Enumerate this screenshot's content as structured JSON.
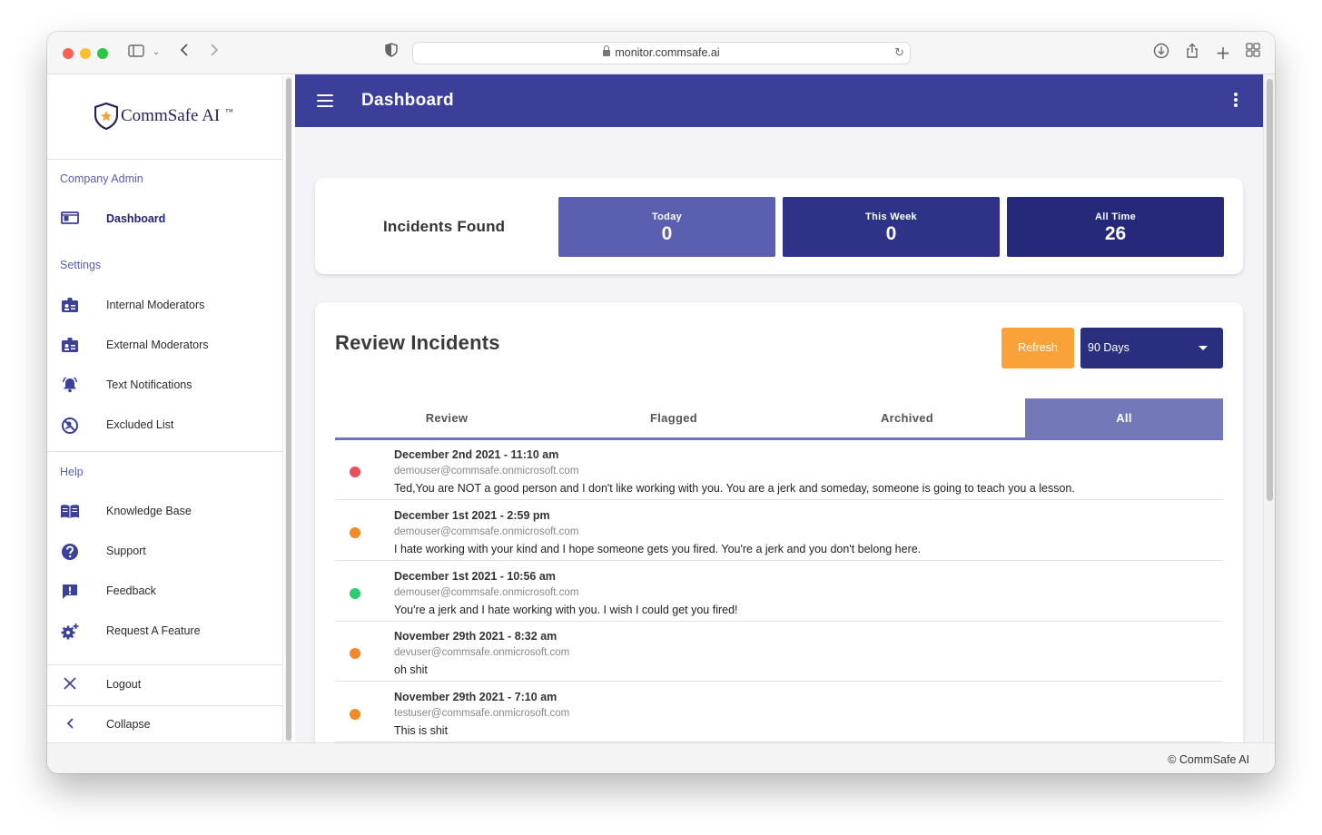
{
  "browser": {
    "url": "monitor.commsafe.ai"
  },
  "sidebar": {
    "brand": "CommSafe AI",
    "trademark": "™",
    "section_company": "Company Admin",
    "dashboard": "Dashboard",
    "section_settings": "Settings",
    "settings_items": [
      "Internal Moderators",
      "External Moderators",
      "Text Notifications",
      "Excluded List"
    ],
    "section_help": "Help",
    "help_items": [
      "Knowledge Base",
      "Support",
      "Feedback",
      "Request A Feature"
    ],
    "logout": "Logout",
    "collapse": "Collapse"
  },
  "header": {
    "title": "Dashboard"
  },
  "incidents_found": {
    "title": "Incidents Found",
    "stats": [
      {
        "label": "Today",
        "value": "0",
        "color": "#5a5fb0"
      },
      {
        "label": "This Week",
        "value": "0",
        "color": "#2f3388"
      },
      {
        "label": "All Time",
        "value": "26",
        "color": "#26297a"
      }
    ]
  },
  "review": {
    "title": "Review Incidents",
    "refresh_label": "Refresh",
    "range_value": "90 Days",
    "tabs": [
      "Review",
      "Flagged",
      "Archived",
      "All"
    ],
    "active_tab": "All",
    "incidents": [
      {
        "date": "December 2nd 2021 - 11:10 am",
        "email": "demouser@commsafe.onmicrosoft.com",
        "message": "Ted,You are NOT a good person and I don't like working with you.  You are a jerk and someday, someone is going to teach you a lesson.",
        "severity_color": "#e9505a"
      },
      {
        "date": "December 1st 2021 - 2:59 pm",
        "email": "demouser@commsafe.onmicrosoft.com",
        "message": "I hate working with your kind and I hope someone gets you fired.  You're a jerk and you don't belong here.",
        "severity_color": "#f28a2a"
      },
      {
        "date": "December 1st 2021 - 10:56 am",
        "email": "demouser@commsafe.onmicrosoft.com",
        "message": "You're a jerk and I hate working with you.  I wish I could get you fired!",
        "severity_color": "#2ecc71"
      },
      {
        "date": "November 29th 2021 - 8:32 am",
        "email": "devuser@commsafe.onmicrosoft.com",
        "message": "oh shit",
        "severity_color": "#f28a2a"
      },
      {
        "date": "November 29th 2021 - 7:10 am",
        "email": "testuser@commsafe.onmicrosoft.com",
        "message": "This is shit",
        "severity_color": "#f28a2a"
      }
    ]
  },
  "footer": {
    "copyright": "© CommSafe AI"
  }
}
